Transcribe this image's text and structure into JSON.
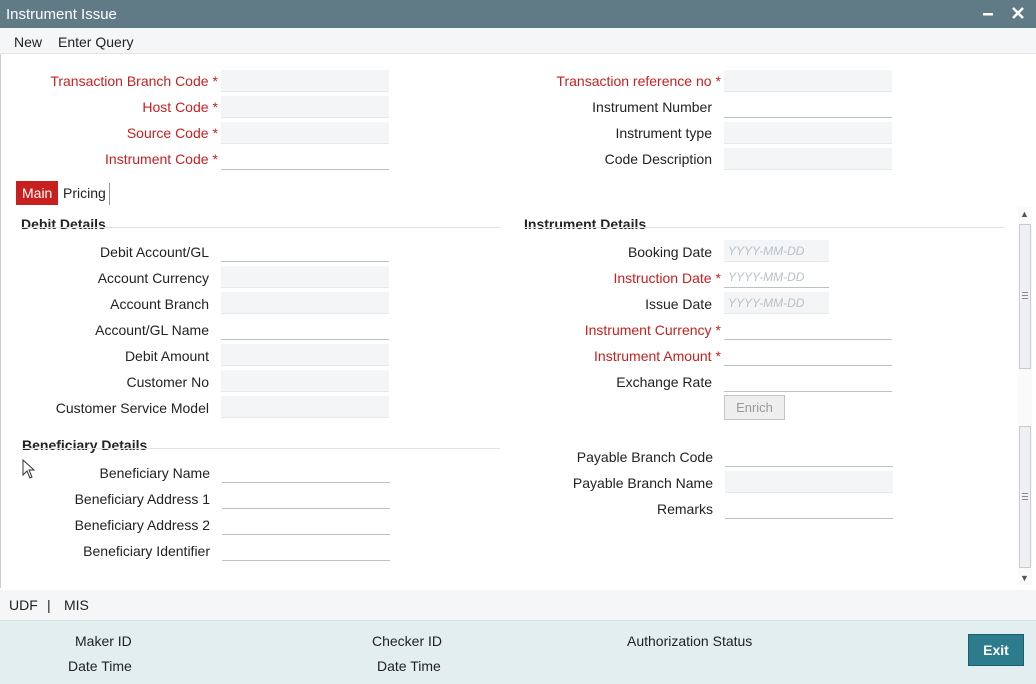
{
  "window": {
    "title": "Instrument Issue"
  },
  "menu": {
    "new": "New",
    "enter_query": "Enter Query"
  },
  "header": {
    "txn_branch_code": "Transaction Branch Code",
    "host_code": "Host Code",
    "source_code": "Source Code",
    "instrument_code": "Instrument Code",
    "txn_ref_no": "Transaction reference no",
    "instrument_number": "Instrument Number",
    "instrument_type": "Instrument type",
    "code_description": "Code Description"
  },
  "tabs": {
    "main": "Main",
    "pricing": "Pricing"
  },
  "debit": {
    "title": "Debit Details",
    "account": "Debit Account/GL",
    "currency": "Account Currency",
    "branch": "Account Branch",
    "name": "Account/GL Name",
    "amount": "Debit Amount",
    "customer_no": "Customer No",
    "service_model": "Customer Service Model"
  },
  "instrument": {
    "title": "Instrument Details",
    "booking_date": "Booking Date",
    "instruction_date": "Instruction Date",
    "issue_date": "Issue Date",
    "currency": "Instrument Currency",
    "amount": "Instrument Amount",
    "exchange_rate": "Exchange Rate",
    "enrich": "Enrich",
    "date_placeholder": "YYYY-MM-DD"
  },
  "beneficiary": {
    "title": "Beneficiary Details",
    "name": "Beneficiary Name",
    "address1": "Beneficiary Address 1",
    "address2": "Beneficiary Address 2",
    "identifier": "Beneficiary Identifier"
  },
  "payable": {
    "branch_code": "Payable Branch Code",
    "branch_name": "Payable Branch Name",
    "remarks": "Remarks"
  },
  "links": {
    "udf": "UDF",
    "sep": "|",
    "mis": "MIS"
  },
  "audit": {
    "maker_id": "Maker ID",
    "maker_dt": "Date Time",
    "checker_id": "Checker ID",
    "checker_dt": "Date Time",
    "auth_status": "Authorization Status",
    "exit": "Exit"
  },
  "required_mark": "*",
  "colors": {
    "titlebar": "#607b85",
    "required": "#c8201f",
    "active_tab": "#c8201f",
    "exit_button": "#2d7c8e"
  }
}
